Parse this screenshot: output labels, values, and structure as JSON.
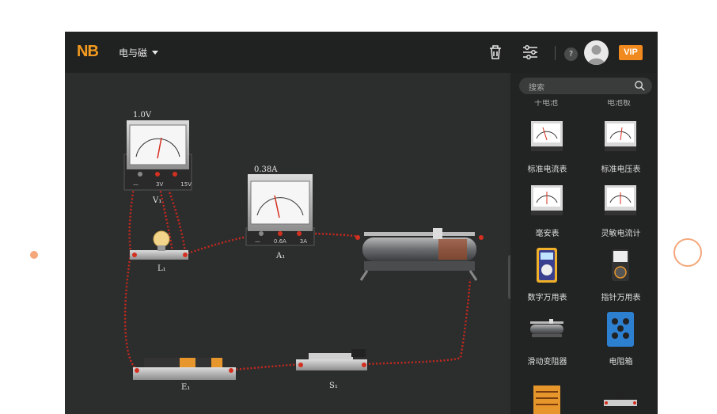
{
  "app": {
    "logo": "NB",
    "menu_title": "电与磁",
    "help_label": "?",
    "vip_label": "VIP"
  },
  "search": {
    "placeholder": "搜索"
  },
  "panel": {
    "cut_labels": [
      "干电池",
      "电池板"
    ],
    "components": [
      {
        "label": "标准电流表",
        "icon": "ammeter-icon"
      },
      {
        "label": "标准电压表",
        "icon": "voltmeter-icon"
      },
      {
        "label": "毫安表",
        "icon": "milliammeter-icon"
      },
      {
        "label": "灵敏电流计",
        "icon": "galvanometer-icon"
      },
      {
        "label": "数字万用表",
        "icon": "digital-multimeter-icon"
      },
      {
        "label": "指针万用表",
        "icon": "analog-multimeter-icon"
      },
      {
        "label": "滑动变阻器",
        "icon": "rheostat-icon"
      },
      {
        "label": "电阻箱",
        "icon": "resistance-box-icon"
      }
    ]
  },
  "circuit": {
    "voltmeter": {
      "reading": "1.0V",
      "label": "V₁",
      "terminals": [
        "—",
        "3V",
        "15V"
      ]
    },
    "ammeter": {
      "reading": "0.38A",
      "label": "A₁",
      "terminals": [
        "—",
        "0.6A",
        "3A"
      ]
    },
    "bulb": {
      "label": "L₁"
    },
    "battery": {
      "label": "E₁"
    },
    "switch": {
      "label": "S₁"
    }
  },
  "colors": {
    "accent": "#f08a1e",
    "wire": "#c8281e",
    "background": "#2c2e2e"
  }
}
